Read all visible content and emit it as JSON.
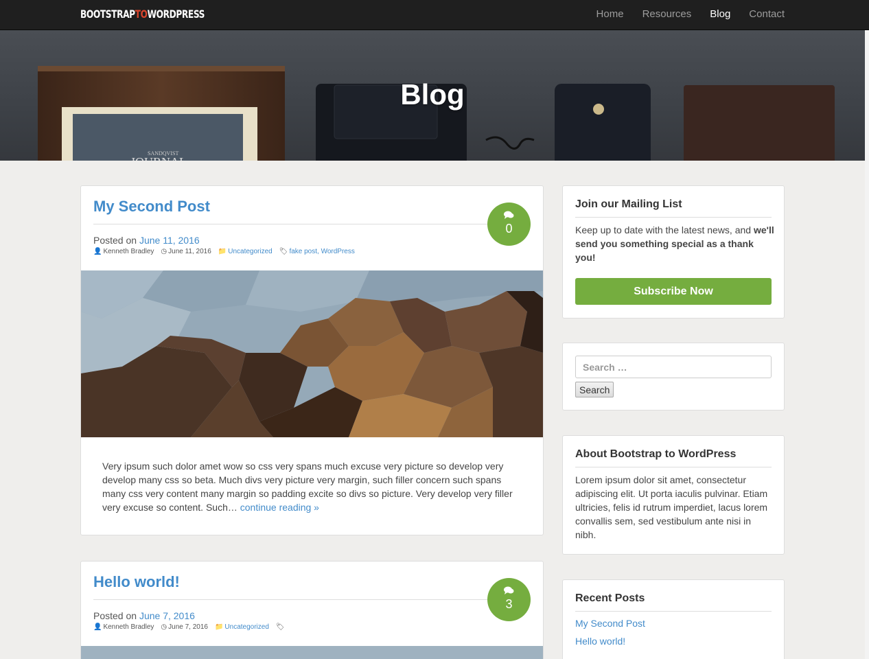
{
  "navbar": {
    "brand_part1": "BOOTSTRAP",
    "brand_part2": "TO",
    "brand_part3": "WORDPRESS",
    "links": [
      {
        "label": "Home",
        "active": false
      },
      {
        "label": "Resources",
        "active": false
      },
      {
        "label": "Blog",
        "active": true
      },
      {
        "label": "Contact",
        "active": false
      }
    ]
  },
  "hero": {
    "title": "Blog",
    "journal_brand": "SANDQVIST",
    "journal_title": "JOURNAL"
  },
  "posts": [
    {
      "title": "My Second Post",
      "comments": "0",
      "posted_prefix": "Posted on",
      "date": "June 11, 2016",
      "author": "Kenneth Bradley",
      "meta_date": "June 11, 2016",
      "category": "Uncategorized",
      "tags": "fake post, WordPress",
      "excerpt": "Very ipsum such dolor amet wow so css very spans much excuse very picture so develop very develop many css so beta. Much divs very picture very margin, such filler concern such spans many css very content many margin so padding excite so divs so picture. Very develop very filler very excuse so content. Such…",
      "read_more": "continue reading »"
    },
    {
      "title": "Hello world!",
      "comments": "3",
      "posted_prefix": "Posted on",
      "date": "June 7, 2016",
      "author": "Kenneth Bradley",
      "meta_date": "June 7, 2016",
      "category": "Uncategorized"
    }
  ],
  "sidebar": {
    "mailing": {
      "title": "Join our Mailing List",
      "text_plain": "Keep up to date with the latest news, and ",
      "text_bold": "we'll send you something special as a thank you!",
      "button": "Subscribe Now"
    },
    "search": {
      "placeholder": "Search …",
      "button": "Search"
    },
    "about": {
      "title": "About Bootstrap to WordPress",
      "text": "Lorem ipsum dolor sit amet, consectetur adipiscing elit. Ut porta iaculis pulvinar. Etiam ultricies, felis id rutrum imperdiet, lacus lorem convallis sem, sed vestibulum ante nisi in nibh."
    },
    "recent": {
      "title": "Recent Posts",
      "items": [
        "My Second Post",
        "Hello world!"
      ]
    }
  },
  "colors": {
    "accent_green": "#75ad3f",
    "link_blue": "#428bca",
    "navbar_bg": "#1f1f1f",
    "brand_to_red": "#d9442c"
  },
  "icons": {
    "comment": "comments-icon",
    "author": "user-icon",
    "date": "clock-icon",
    "category": "folder-icon",
    "tags": "tags-icon"
  }
}
